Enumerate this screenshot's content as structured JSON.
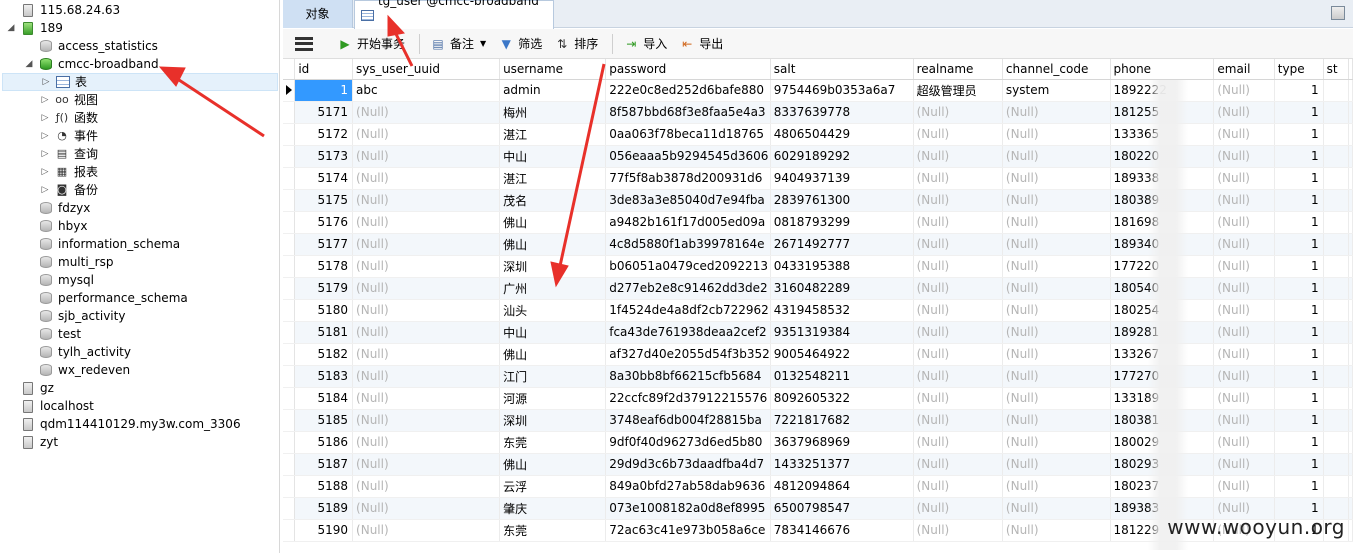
{
  "tree": {
    "items": [
      {
        "label": "115.68.24.63",
        "icon": "server-icon"
      },
      {
        "label": "189",
        "icon": "server-icon"
      },
      {
        "label": "access_statistics",
        "icon": "database-icon"
      },
      {
        "label": "cmcc-broadband",
        "icon": "database-icon"
      },
      {
        "label": "表",
        "icon": "table-icon"
      },
      {
        "label": "视图",
        "icon": "view-icon"
      },
      {
        "label": "函数",
        "icon": "function-icon"
      },
      {
        "label": "事件",
        "icon": "event-icon"
      },
      {
        "label": "查询",
        "icon": "query-icon"
      },
      {
        "label": "报表",
        "icon": "report-icon"
      },
      {
        "label": "备份",
        "icon": "backup-icon"
      },
      {
        "label": "fdzyx",
        "icon": "database-icon"
      },
      {
        "label": "hbyx",
        "icon": "database-icon"
      },
      {
        "label": "information_schema",
        "icon": "database-icon"
      },
      {
        "label": "multi_rsp",
        "icon": "database-icon"
      },
      {
        "label": "mysql",
        "icon": "database-icon"
      },
      {
        "label": "performance_schema",
        "icon": "database-icon"
      },
      {
        "label": "sjb_activity",
        "icon": "database-icon"
      },
      {
        "label": "test",
        "icon": "database-icon"
      },
      {
        "label": "tylh_activity",
        "icon": "database-icon"
      },
      {
        "label": "wx_redeven",
        "icon": "database-icon"
      },
      {
        "label": "gz",
        "icon": "server-icon"
      },
      {
        "label": "localhost",
        "icon": "server-icon"
      },
      {
        "label": "qdm114410129.my3w.com_3306",
        "icon": "server-icon"
      },
      {
        "label": "zyt",
        "icon": "server-icon"
      }
    ]
  },
  "tabs": {
    "objects_label": "对象",
    "active_label": "tg_user @cmcc-broadband ..."
  },
  "toolbar": {
    "begin_transaction": "开始事务",
    "memo": "备注",
    "filter": "筛选",
    "sort": "排序",
    "import": "导入",
    "export": "导出"
  },
  "grid": {
    "columns": [
      "id",
      "sys_user_uuid",
      "username",
      "password",
      "salt",
      "realname",
      "channel_code",
      "phone",
      "email",
      "type",
      "st"
    ],
    "rows": [
      [
        "1",
        "abc",
        "admin",
        "222e0c8ed252d6bafe880",
        "9754469b0353a6a7",
        "超级管理员",
        "system",
        "1892222",
        "(Null)",
        "1",
        ""
      ],
      [
        "5171",
        "(Null)",
        "梅州",
        "8f587bbd68f3e8faa5e4a3",
        "8337639778",
        "(Null)",
        "(Null)",
        "181255",
        "(Null)",
        "1",
        ""
      ],
      [
        "5172",
        "(Null)",
        "湛江",
        "0aa063f78beca11d18765",
        "4806504429",
        "(Null)",
        "(Null)",
        "133365",
        "(Null)",
        "1",
        ""
      ],
      [
        "5173",
        "(Null)",
        "中山",
        "056eaaa5b9294545d3606",
        "6029189292",
        "(Null)",
        "(Null)",
        "180220",
        "(Null)",
        "1",
        ""
      ],
      [
        "5174",
        "(Null)",
        "湛江",
        "77f5f8ab3878d200931d6",
        "9404937139",
        "(Null)",
        "(Null)",
        "189338",
        "(Null)",
        "1",
        ""
      ],
      [
        "5175",
        "(Null)",
        "茂名",
        "3de83a3e85040d7e94fba",
        "2839761300",
        "(Null)",
        "(Null)",
        "180389",
        "(Null)",
        "1",
        ""
      ],
      [
        "5176",
        "(Null)",
        "佛山",
        "a9482b161f17d005ed09a",
        "0818793299",
        "(Null)",
        "(Null)",
        "181698",
        "(Null)",
        "1",
        ""
      ],
      [
        "5177",
        "(Null)",
        "佛山",
        "4c8d5880f1ab39978164e",
        "2671492777",
        "(Null)",
        "(Null)",
        "189340",
        "(Null)",
        "1",
        ""
      ],
      [
        "5178",
        "(Null)",
        "深圳",
        "b06051a0479ced2092213",
        "0433195388",
        "(Null)",
        "(Null)",
        "177220",
        "(Null)",
        "1",
        ""
      ],
      [
        "5179",
        "(Null)",
        "广州",
        "d277eb2e8c91462dd3de2",
        "3160482289",
        "(Null)",
        "(Null)",
        "180540",
        "(Null)",
        "1",
        ""
      ],
      [
        "5180",
        "(Null)",
        "汕头",
        "1f4524de4a8df2cb722962",
        "4319458532",
        "(Null)",
        "(Null)",
        "180254",
        "(Null)",
        "1",
        ""
      ],
      [
        "5181",
        "(Null)",
        "中山",
        "fca43de761938deaa2cef2",
        "9351319384",
        "(Null)",
        "(Null)",
        "189281",
        "(Null)",
        "1",
        ""
      ],
      [
        "5182",
        "(Null)",
        "佛山",
        "af327d40e2055d54f3b352",
        "9005464922",
        "(Null)",
        "(Null)",
        "133267",
        "(Null)",
        "1",
        ""
      ],
      [
        "5183",
        "(Null)",
        "江门",
        "8a30bb8bf66215cfb5684",
        "0132548211",
        "(Null)",
        "(Null)",
        "177270",
        "(Null)",
        "1",
        ""
      ],
      [
        "5184",
        "(Null)",
        "河源",
        "22ccfc89f2d37912215576",
        "8092605322",
        "(Null)",
        "(Null)",
        "133189",
        "(Null)",
        "1",
        ""
      ],
      [
        "5185",
        "(Null)",
        "深圳",
        "3748eaf6db004f28815ba",
        "7221817682",
        "(Null)",
        "(Null)",
        "180381",
        "(Null)",
        "1",
        ""
      ],
      [
        "5186",
        "(Null)",
        "东莞",
        "9df0f40d96273d6ed5b80",
        "3637968969",
        "(Null)",
        "(Null)",
        "180029",
        "(Null)",
        "1",
        ""
      ],
      [
        "5187",
        "(Null)",
        "佛山",
        "29d9d3c6b73daadfba4d7",
        "1433251377",
        "(Null)",
        "(Null)",
        "180293",
        "(Null)",
        "1",
        ""
      ],
      [
        "5188",
        "(Null)",
        "云浮",
        "849a0bfd27ab58dab9636",
        "4812094864",
        "(Null)",
        "(Null)",
        "180237",
        "(Null)",
        "1",
        ""
      ],
      [
        "5189",
        "(Null)",
        "肇庆",
        "073e1008182a0d8ef8995",
        "6500798547",
        "(Null)",
        "(Null)",
        "189383",
        "(Null)",
        "1",
        ""
      ],
      [
        "5190",
        "(Null)",
        "东莞",
        "72ac63c41e973b058a6ce",
        "7834146676",
        "(Null)",
        "(Null)",
        "181229",
        "(Null)",
        "1",
        ""
      ]
    ]
  },
  "watermark": "www.wooyun.org",
  "colors": {
    "annotation_arrow": "#e8302a",
    "selected_cell": "#3399ff",
    "null_text": "#b5b5b5"
  }
}
